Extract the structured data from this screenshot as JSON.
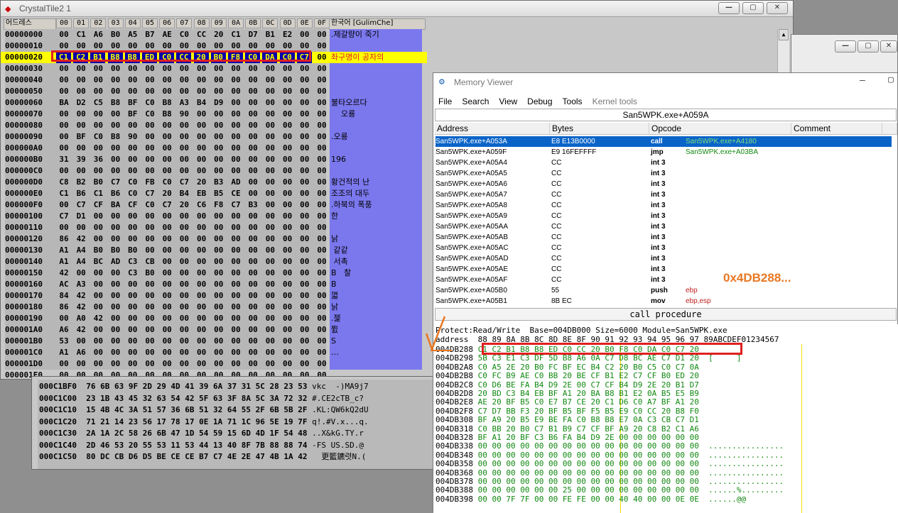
{
  "crystal": {
    "title": "CrystalTile2 1",
    "addr_header": "어드레스",
    "text_header": "한국어 [GulimChe]",
    "col_headers": [
      "00",
      "01",
      "02",
      "03",
      "04",
      "05",
      "06",
      "07",
      "08",
      "09",
      "0A",
      "0B",
      "0C",
      "0D",
      "0E",
      "0F"
    ],
    "rows": [
      {
        "addr": "00000000",
        "bytes": [
          "00",
          "C1",
          "A6",
          "B0",
          "A5",
          "B7",
          "AE",
          "C0",
          "CC",
          "20",
          "C1",
          "D7",
          "B1",
          "E2",
          "00",
          "00"
        ],
        "text": ".제갈량이 죽기"
      },
      {
        "addr": "00000010",
        "bytes": [
          "00",
          "00",
          "00",
          "00",
          "00",
          "00",
          "00",
          "00",
          "00",
          "00",
          "00",
          "00",
          "00",
          "00",
          "00",
          "00"
        ],
        "text": ""
      },
      {
        "addr": "00000020",
        "bytes": [
          "C1",
          "C2",
          "B1",
          "B8",
          "B8",
          "ED",
          "C0",
          "CC",
          "20",
          "B0",
          "F8",
          "C0",
          "DA",
          "C0",
          "C7",
          "00"
        ],
        "text": "좌구명이 공자의"
      },
      {
        "addr": "00000030",
        "bytes": [
          "00",
          "00",
          "00",
          "00",
          "00",
          "00",
          "00",
          "00",
          "00",
          "00",
          "00",
          "00",
          "00",
          "00",
          "00",
          "00"
        ],
        "text": ""
      },
      {
        "addr": "00000040",
        "bytes": [
          "00",
          "00",
          "00",
          "00",
          "00",
          "00",
          "00",
          "00",
          "00",
          "00",
          "00",
          "00",
          "00",
          "00",
          "00",
          "00"
        ],
        "text": ""
      },
      {
        "addr": "00000050",
        "bytes": [
          "00",
          "00",
          "00",
          "00",
          "00",
          "00",
          "00",
          "00",
          "00",
          "00",
          "00",
          "00",
          "00",
          "00",
          "00",
          "00"
        ],
        "text": ""
      },
      {
        "addr": "00000060",
        "bytes": [
          "BA",
          "D2",
          "C5",
          "B8",
          "BF",
          "C0",
          "B8",
          "A3",
          "B4",
          "D9",
          "00",
          "00",
          "00",
          "00",
          "00",
          "00"
        ],
        "text": "불타오르다"
      },
      {
        "addr": "00000070",
        "bytes": [
          "00",
          "00",
          "00",
          "00",
          "BF",
          "C0",
          "B8",
          "90",
          "00",
          "00",
          "00",
          "00",
          "00",
          "00",
          "00",
          "00"
        ],
        "text": "    오룡"
      },
      {
        "addr": "00000080",
        "bytes": [
          "00",
          "00",
          "00",
          "00",
          "00",
          "00",
          "00",
          "00",
          "00",
          "00",
          "00",
          "00",
          "00",
          "00",
          "00",
          "00"
        ],
        "text": ""
      },
      {
        "addr": "00000090",
        "bytes": [
          "00",
          "BF",
          "C0",
          "B8",
          "90",
          "00",
          "00",
          "00",
          "00",
          "00",
          "00",
          "00",
          "00",
          "00",
          "00",
          "00"
        ],
        "text": ".오룡"
      },
      {
        "addr": "000000A0",
        "bytes": [
          "00",
          "00",
          "00",
          "00",
          "00",
          "00",
          "00",
          "00",
          "00",
          "00",
          "00",
          "00",
          "00",
          "00",
          "00",
          "00"
        ],
        "text": ""
      },
      {
        "addr": "000000B0",
        "bytes": [
          "31",
          "39",
          "36",
          "00",
          "00",
          "00",
          "00",
          "00",
          "00",
          "00",
          "00",
          "00",
          "00",
          "00",
          "00",
          "00"
        ],
        "text": "196"
      },
      {
        "addr": "000000C0",
        "bytes": [
          "00",
          "00",
          "00",
          "00",
          "00",
          "00",
          "00",
          "00",
          "00",
          "00",
          "00",
          "00",
          "00",
          "00",
          "00",
          "00"
        ],
        "text": ""
      },
      {
        "addr": "000000D0",
        "bytes": [
          "C8",
          "B2",
          "B0",
          "C7",
          "C0",
          "FB",
          "C0",
          "C7",
          "20",
          "B3",
          "AD",
          "00",
          "00",
          "00",
          "00",
          "00"
        ],
        "text": "황건적의 난"
      },
      {
        "addr": "000000E0",
        "bytes": [
          "C1",
          "B6",
          "C1",
          "B6",
          "C0",
          "C7",
          "20",
          "B4",
          "EB",
          "B5",
          "CE",
          "00",
          "00",
          "00",
          "00",
          "00"
        ],
        "text": "조조의 대두"
      },
      {
        "addr": "000000F0",
        "bytes": [
          "00",
          "C7",
          "CF",
          "BA",
          "CF",
          "C0",
          "C7",
          "20",
          "C6",
          "F8",
          "C7",
          "B3",
          "00",
          "00",
          "00",
          "00"
        ],
        "text": ".하북의 폭풍"
      },
      {
        "addr": "00000100",
        "bytes": [
          "C7",
          "D1",
          "00",
          "00",
          "00",
          "00",
          "00",
          "00",
          "00",
          "00",
          "00",
          "00",
          "00",
          "00",
          "00",
          "00"
        ],
        "text": "한"
      },
      {
        "addr": "00000110",
        "bytes": [
          "00",
          "00",
          "00",
          "00",
          "00",
          "00",
          "00",
          "00",
          "00",
          "00",
          "00",
          "00",
          "00",
          "00",
          "00",
          "00"
        ],
        "text": ""
      },
      {
        "addr": "00000120",
        "bytes": [
          "86",
          "42",
          "00",
          "00",
          "00",
          "00",
          "00",
          "00",
          "00",
          "00",
          "00",
          "00",
          "00",
          "00",
          "00",
          "00"
        ],
        "text": "낡"
      },
      {
        "addr": "00000130",
        "bytes": [
          "A1",
          "A4",
          "B0",
          "B0",
          "B0",
          "00",
          "00",
          "00",
          "00",
          "00",
          "00",
          "00",
          "00",
          "00",
          "00",
          "00"
        ],
        "text": " 같같"
      },
      {
        "addr": "00000140",
        "bytes": [
          "A1",
          "A4",
          "BC",
          "AD",
          "C3",
          "CB",
          "00",
          "00",
          "00",
          "00",
          "00",
          "00",
          "00",
          "00",
          "00",
          "00"
        ],
        "text": " 서촉"
      },
      {
        "addr": "00000150",
        "bytes": [
          "42",
          "00",
          "00",
          "00",
          "C3",
          "B0",
          "00",
          "00",
          "00",
          "00",
          "00",
          "00",
          "00",
          "00",
          "00",
          "00"
        ],
        "text": "B   찰"
      },
      {
        "addr": "00000160",
        "bytes": [
          "AC",
          "A3",
          "00",
          "00",
          "00",
          "00",
          "00",
          "00",
          "00",
          "00",
          "00",
          "00",
          "00",
          "00",
          "00",
          "00"
        ],
        "text": "Β"
      },
      {
        "addr": "00000170",
        "bytes": [
          "84",
          "42",
          "00",
          "00",
          "00",
          "00",
          "00",
          "00",
          "00",
          "00",
          "00",
          "00",
          "00",
          "00",
          "00",
          "00"
        ],
        "text": "껿"
      },
      {
        "addr": "00000180",
        "bytes": [
          "86",
          "42",
          "00",
          "00",
          "00",
          "00",
          "00",
          "00",
          "00",
          "00",
          "00",
          "00",
          "00",
          "00",
          "00",
          "00"
        ],
        "text": "낡"
      },
      {
        "addr": "00000190",
        "bytes": [
          "00",
          "A0",
          "42",
          "00",
          "00",
          "00",
          "00",
          "00",
          "00",
          "00",
          "00",
          "00",
          "00",
          "00",
          "00",
          "00"
        ],
        "text": ".젩"
      },
      {
        "addr": "000001A0",
        "bytes": [
          "A6",
          "42",
          "00",
          "00",
          "00",
          "00",
          "00",
          "00",
          "00",
          "00",
          "00",
          "00",
          "00",
          "00",
          "00",
          "00"
        ],
        "text": "쮨"
      },
      {
        "addr": "000001B0",
        "bytes": [
          "53",
          "00",
          "00",
          "00",
          "00",
          "00",
          "00",
          "00",
          "00",
          "00",
          "00",
          "00",
          "00",
          "00",
          "00",
          "00"
        ],
        "text": "S"
      },
      {
        "addr": "000001C0",
        "bytes": [
          "A1",
          "A6",
          "00",
          "00",
          "00",
          "00",
          "00",
          "00",
          "00",
          "00",
          "00",
          "00",
          "00",
          "00",
          "00",
          "00"
        ],
        "text": "…"
      },
      {
        "addr": "000001D0",
        "bytes": [
          "00",
          "00",
          "00",
          "00",
          "00",
          "00",
          "00",
          "00",
          "00",
          "00",
          "00",
          "00",
          "00",
          "00",
          "00",
          "00"
        ],
        "text": ""
      },
      {
        "addr": "000001E0",
        "bytes": [
          "00",
          "00",
          "00",
          "00",
          "00",
          "00",
          "00",
          "00",
          "00",
          "00",
          "00",
          "00",
          "00",
          "00",
          "00",
          "00"
        ],
        "text": ""
      }
    ]
  },
  "hex2": {
    "rows": [
      {
        "addr": "000C1BF0",
        "bytes": "76 6B 63 9F 2D 29 4D 41 39 6A 37 31 5C 28 23 53",
        "text": "vkc  -)MA9j7"
      },
      {
        "addr": "000C1C00",
        "bytes": "23 1B 43 45 32 63 54 42 5F 63 3F 8A 5C 3A 72 32",
        "text": "#.CE2cTB_c?"
      },
      {
        "addr": "000C1C10",
        "bytes": "15 4B 4C 3A 51 57 36 6B 51 32 64 55 2F 6B 5B 2F",
        "text": ".KL:QW6kQ2dU"
      },
      {
        "addr": "000C1C20",
        "bytes": "71 21 14 23 56 17 78 17 0E 1A 71 1C 96 5E 19 7F",
        "text": "q!.#V.x...q."
      },
      {
        "addr": "000C1C30",
        "bytes": "2A 1A 2C 58 26 6B 47 1D 54 59 15 6D 4D 1F 54 48",
        "text": "..X&kG.TY.r"
      },
      {
        "addr": "000C1C40",
        "bytes": "2D 46 53 20 55 53 11 53 44 13 40 8F 7B 88 88 74",
        "text": "-FS US.SD.@"
      },
      {
        "addr": "000C1C50",
        "bytes": "80 DC CB D6 D5 BE CE CE B7 C7 4E 2E 47 4B 1A 42",
        "text": "  更籃鑣렷N.("
      }
    ]
  },
  "mv": {
    "title": "Memory Viewer",
    "menu": [
      "File",
      "Search",
      "View",
      "Debug",
      "Tools",
      "Kernel tools"
    ],
    "location": "San5WPK.exe+A059A",
    "columns": [
      "Address",
      "Bytes",
      "Opcode",
      "Comment"
    ],
    "rows": [
      {
        "addr": "San5WPK.exe+A053A",
        "bytes": "E8 E13B0000",
        "op": "call",
        "arg": "San5WPK.exe+A4180",
        "selected": true
      },
      {
        "addr": "San5WPK.exe+A059F",
        "bytes": "E9 16FEFFFF",
        "op": "jmp",
        "arg": "San5WPK.exe+A03BA"
      },
      {
        "addr": "San5WPK.exe+A05A4",
        "bytes": "CC",
        "op": "int 3",
        "arg": ""
      },
      {
        "addr": "San5WPK.exe+A05A5",
        "bytes": "CC",
        "op": "int 3",
        "arg": ""
      },
      {
        "addr": "San5WPK.exe+A05A6",
        "bytes": "CC",
        "op": "int 3",
        "arg": ""
      },
      {
        "addr": "San5WPK.exe+A05A7",
        "bytes": "CC",
        "op": "int 3",
        "arg": ""
      },
      {
        "addr": "San5WPK.exe+A05A8",
        "bytes": "CC",
        "op": "int 3",
        "arg": ""
      },
      {
        "addr": "San5WPK.exe+A05A9",
        "bytes": "CC",
        "op": "int 3",
        "arg": ""
      },
      {
        "addr": "San5WPK.exe+A05AA",
        "bytes": "CC",
        "op": "int 3",
        "arg": ""
      },
      {
        "addr": "San5WPK.exe+A05AB",
        "bytes": "CC",
        "op": "int 3",
        "arg": ""
      },
      {
        "addr": "San5WPK.exe+A05AC",
        "bytes": "CC",
        "op": "int 3",
        "arg": ""
      },
      {
        "addr": "San5WPK.exe+A05AD",
        "bytes": "CC",
        "op": "int 3",
        "arg": ""
      },
      {
        "addr": "San5WPK.exe+A05AE",
        "bytes": "CC",
        "op": "int 3",
        "arg": ""
      },
      {
        "addr": "San5WPK.exe+A05AF",
        "bytes": "CC",
        "op": "int 3",
        "arg": ""
      },
      {
        "addr": "San5WPK.exe+A05B0",
        "bytes": "55",
        "op": "push",
        "arg": "ebp"
      },
      {
        "addr": "San5WPK.exe+A05B1",
        "bytes": "8B EC",
        "op": "mov",
        "arg": "ebp,esp"
      }
    ],
    "annotation": "0x4DB288...",
    "status": "call procedure",
    "protect": "Protect:Read/Write  Base=004DB000 Size=6000 Module=San5WPK.exe",
    "dump_header": "address  88 89 8A 8B 8C 8D 8E 8F 90 91 92 93 94 95 96 97 89ABCDEF01234567",
    "dump": [
      {
        "addr": "004DB288",
        "bytes": "C1 C2 B1 B8 B8 ED C0 CC 20 B0 F8 C0 DA C0 C7 20",
        "ascii": ""
      },
      {
        "addr": "004DB298",
        "bytes": "5B C3 E1 C3 DF 5D B8 A6 0A C7 D8 BC AE C7 D1 20",
        "ascii": "[     ]"
      },
      {
        "addr": "004DB2A8",
        "bytes": "C0 A5 2E 20 B0 FC BF EC B4 C2 20 B0 C5 C0 C7 0A",
        "ascii": ""
      },
      {
        "addr": "004DB2B8",
        "bytes": "C0 FC B9 AE C0 BB 20 BE CF B1 E2 C7 CF B0 ED 20",
        "ascii": ""
      },
      {
        "addr": "004DB2C8",
        "bytes": "C0 D6 BE FA B4 D9 2E 00 C7 CF B4 D9 2E 20 B1 D7",
        "ascii": ""
      },
      {
        "addr": "004DB2D8",
        "bytes": "20 BD C3 B4 EB BF A1 20 BA B8 B1 E2 0A B5 E5 B9",
        "ascii": ""
      },
      {
        "addr": "004DB2E8",
        "bytes": "AE 20 BF B5 C0 E7 B7 CE 20 C1 D6 C0 A7 BF A1 20",
        "ascii": ""
      },
      {
        "addr": "004DB2F8",
        "bytes": "C7 D7 BB F3 20 BF B5 BF F5 B5 E9 C0 CC 20 B8 F0",
        "ascii": ""
      },
      {
        "addr": "004DB308",
        "bytes": "BF A9 20 B5 E9 BE FA C0 B8 B8 E7 0A C3 CB C7 D1",
        "ascii": ""
      },
      {
        "addr": "004DB318",
        "bytes": "C0 BB 20 B0 C7 B1 B9 C7 CF BF A9 20 C8 B2 C1 A6",
        "ascii": ""
      },
      {
        "addr": "004DB328",
        "bytes": "BF A1 20 BF C3 B6 FA B4 D9 2E 00 00 00 00 00 00",
        "ascii": ""
      },
      {
        "addr": "004DB338",
        "bytes": "00 00 00 00 00 00 00 00 00 00 00 00 00 00 00 00",
        "ascii": "................"
      },
      {
        "addr": "004DB348",
        "bytes": "00 00 00 00 00 00 00 00 00 00 00 00 00 00 00 00",
        "ascii": "................"
      },
      {
        "addr": "004DB358",
        "bytes": "00 00 00 00 00 00 00 00 00 00 00 00 00 00 00 00",
        "ascii": "................"
      },
      {
        "addr": "004DB368",
        "bytes": "00 00 00 00 00 00 00 00 00 00 00 00 00 00 00 00",
        "ascii": "................"
      },
      {
        "addr": "004DB378",
        "bytes": "00 00 00 00 00 00 00 00 00 00 00 00 00 00 00 00",
        "ascii": "................"
      },
      {
        "addr": "004DB388",
        "bytes": "00 00 00 00 00 00 25 00 00 00 00 00 00 00 00 00",
        "ascii": "......%........."
      },
      {
        "addr": "004DB398",
        "bytes": "00 00 7F 7F 00 00 FE FE 00 00 40 40 00 00 0E 0E",
        "ascii": "......@@"
      }
    ]
  },
  "colors": {
    "highlight": "#e02020",
    "annotation": "#e87722",
    "selection": "#0a64c8",
    "text_panel": "#7b78ee"
  }
}
